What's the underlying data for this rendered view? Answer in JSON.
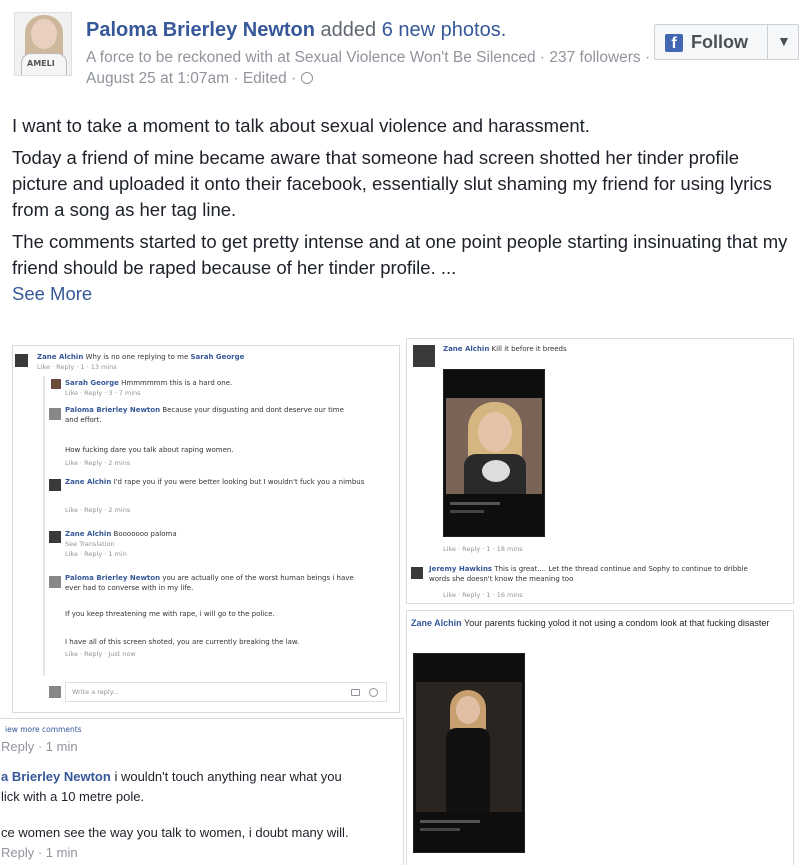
{
  "header": {
    "name": "Paloma Brierley Newton",
    "action": "added",
    "count": "6 new photos.",
    "subline": "A force to be reckoned with at Sexual Violence Won't Be Silenced · 237 followers · August 25 at 1:07am · Edited ·",
    "follow_label": "Follow",
    "avatar_shirt_text": "AMELI"
  },
  "post": {
    "p1": "I want to take a moment to talk about sexual violence and harassment.",
    "p2": "Today a friend of mine became aware that someone had screen shotted her tinder profile picture and uploaded it onto their facebook, essentially slut shaming my friend for using lyrics from a song as her tag line.",
    "p3": "The comments started to get pretty intense and at one point people starting insinuating that my friend should be raped because of her tinder profile. ...",
    "see_more": "See More"
  },
  "shot1": {
    "c1_name": "Zane Alchin",
    "c1_text": "Why is no one replying to me",
    "c1_tag": "Sarah George",
    "c1_meta": "Like · Reply · 1 · 13 mins",
    "c2_name": "Sarah George",
    "c2_text": "Hmmmmmm this is a hard one.",
    "c2_meta": "Like · Reply · 3 · 7 mins",
    "c3_name": "Paloma Brierley Newton",
    "c3_text": "Because your disgusting and dont deserve our time and effort.",
    "c3b_text": "How fucking dare you talk about raping women.",
    "c3_meta": "Like · Reply · 2 mins",
    "c4_name": "Zane Alchin",
    "c4_text": "I'd rape you if you were better looking but I wouldn't fuck you a nimbus",
    "c4_meta": "Like · Reply · 2 mins",
    "c5_name": "Zane Alchin",
    "c5_text": "Booooooo paloma",
    "c5_trans": "See Translation",
    "c5_meta": "Like · Reply · 1 min",
    "c6_name": "Paloma Brierley Newton",
    "c6_text": "you are actually one of the worst human beings i have ever had to converse with in my life.",
    "c6b_text": "If you keep threatening me with rape, i will go to the police.",
    "c6c_text": "I have all of this screen shoted, you are currently breaking the law.",
    "c6_meta": "Like · Reply · Just now",
    "reply_placeholder": "Write a reply..."
  },
  "shot2": {
    "more": "iew more comments",
    "meta1": "Reply · 1 min",
    "l1_name": "a Brierley Newton",
    "l1_text": "i wouldn't touch anything near what you",
    "l1b": "lick with a 10 metre pole.",
    "l2": "ce women see the way you talk to women, i doubt many will.",
    "meta2": "Reply · 1 min"
  },
  "shot3": {
    "c1_name": "Zane Alchin",
    "c1_text": "Kill it before it breeds",
    "meta1": "Like · Reply · 1 · 18 mins",
    "c2_name": "Jeremy Hawkins",
    "c2_text": "This is great.... Let the thread continue and Sophy to continue to dribble words she doesn't know the meaning too",
    "meta2": "Like · Reply · 1 · 16 mins"
  },
  "shot4": {
    "c1_name": "Zane Alchin",
    "c1_text": "Your parents fucking yolod it not using a condom look at that fucking disaster"
  },
  "colors": {
    "brand": "#4267b2",
    "link": "#365899",
    "meta": "#90949c"
  }
}
